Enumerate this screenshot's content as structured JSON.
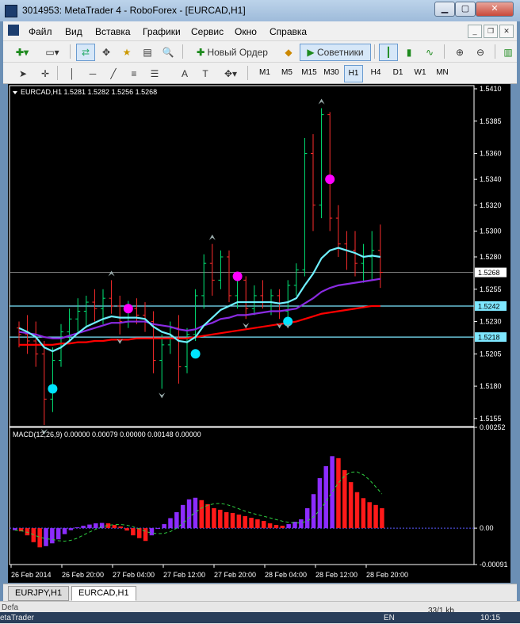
{
  "window": {
    "title": "3014953: MetaTrader 4 - RoboForex - [EURCAD,H1]"
  },
  "menu": [
    "Файл",
    "Вид",
    "Вставка",
    "Графики",
    "Сервис",
    "Окно",
    "Справка"
  ],
  "toolbar": {
    "new_order": "Новый Ордер",
    "advisors": "Советники"
  },
  "timeframes": [
    "M1",
    "M5",
    "M15",
    "M30",
    "H1",
    "H4",
    "D1",
    "W1",
    "MN"
  ],
  "active_timeframe": "H1",
  "chart": {
    "header": "EURCAD,H1  1.5281 1.5282 1.5256 1.5268",
    "price_ticks": [
      "1.5410",
      "1.5385",
      "1.5360",
      "1.5340",
      "1.5320",
      "1.5300",
      "1.5280",
      "1.5255",
      "1.5230",
      "1.5205",
      "1.5180",
      "1.5155"
    ],
    "current_price": "1.5268",
    "hline_upper": "1.5242",
    "hline_lower": "1.5218",
    "macd_header": "MACD(12,26,9) 0.00000 0.00079 0.00000 0.00148 0.00000",
    "macd_ticks": [
      "0.00252",
      "0.00",
      "-0.00091"
    ],
    "time_labels": [
      "26 Feb 2014",
      "26 Feb 20:00",
      "27 Feb 04:00",
      "27 Feb 12:00",
      "27 Feb 20:00",
      "28 Feb 04:00",
      "28 Feb 12:00",
      "28 Feb 20:00"
    ],
    "colors": {
      "bg": "#000000",
      "bull": "#00e676",
      "bear": "#ff2d2d",
      "ma_fast": "#6ff0ff",
      "ma_mid": "#8a2be2",
      "ma_slow": "#ff0000",
      "hline": "#7ee7ff",
      "macd_up": "#8c2cff",
      "macd_down": "#ff1a1a",
      "signal": "#2ecc40"
    }
  },
  "chart_data": {
    "type": "candlestick",
    "symbol": "EURCAD",
    "timeframe": "H1",
    "ylim": [
      1.515,
      1.541
    ],
    "candles": [
      [
        1.5225,
        1.523,
        1.521,
        1.522
      ],
      [
        1.522,
        1.5235,
        1.5205,
        1.5215
      ],
      [
        1.5215,
        1.523,
        1.5195,
        1.5205
      ],
      [
        1.5205,
        1.5215,
        1.515,
        1.517
      ],
      [
        1.517,
        1.521,
        1.516,
        1.52
      ],
      [
        1.52,
        1.5228,
        1.5195,
        1.5222
      ],
      [
        1.5222,
        1.524,
        1.5215,
        1.5232
      ],
      [
        1.5232,
        1.5248,
        1.5222,
        1.5238
      ],
      [
        1.5238,
        1.525,
        1.5225,
        1.5245
      ],
      [
        1.5245,
        1.5255,
        1.523,
        1.524
      ],
      [
        1.524,
        1.5255,
        1.5228,
        1.5248
      ],
      [
        1.5248,
        1.5262,
        1.5236,
        1.5242
      ],
      [
        1.5242,
        1.525,
        1.522,
        1.523
      ],
      [
        1.523,
        1.5246,
        1.5225,
        1.524
      ],
      [
        1.524,
        1.5248,
        1.5228,
        1.5235
      ],
      [
        1.5235,
        1.5245,
        1.5222,
        1.523
      ],
      [
        1.523,
        1.5238,
        1.519,
        1.52
      ],
      [
        1.52,
        1.522,
        1.5178,
        1.5212
      ],
      [
        1.5212,
        1.523,
        1.5205,
        1.5225
      ],
      [
        1.5225,
        1.5235,
        1.5182,
        1.5195
      ],
      [
        1.5195,
        1.5225,
        1.519,
        1.522
      ],
      [
        1.522,
        1.5255,
        1.5215,
        1.525
      ],
      [
        1.525,
        1.5282,
        1.524,
        1.5275
      ],
      [
        1.5275,
        1.529,
        1.525,
        1.5262
      ],
      [
        1.5262,
        1.5285,
        1.5255,
        1.528
      ],
      [
        1.528,
        1.5285,
        1.5245,
        1.525
      ],
      [
        1.525,
        1.5268,
        1.524,
        1.5262
      ],
      [
        1.5262,
        1.5265,
        1.5232,
        1.524
      ],
      [
        1.524,
        1.5258,
        1.5235,
        1.525
      ],
      [
        1.525,
        1.5262,
        1.524,
        1.5245
      ],
      [
        1.5245,
        1.5255,
        1.5235,
        1.525
      ],
      [
        1.525,
        1.5255,
        1.5232,
        1.5238
      ],
      [
        1.5238,
        1.5262,
        1.5232,
        1.5258
      ],
      [
        1.5258,
        1.5275,
        1.525,
        1.527
      ],
      [
        1.527,
        1.5372,
        1.5265,
        1.536
      ],
      [
        1.536,
        1.5375,
        1.53,
        1.532
      ],
      [
        1.532,
        1.5395,
        1.531,
        1.539
      ],
      [
        1.539,
        1.5392,
        1.53,
        1.531
      ],
      [
        1.531,
        1.532,
        1.528,
        1.529
      ],
      [
        1.529,
        1.53,
        1.527,
        1.5285
      ],
      [
        1.5285,
        1.53,
        1.5265,
        1.5275
      ],
      [
        1.5275,
        1.529,
        1.526,
        1.528
      ],
      [
        1.528,
        1.53,
        1.5262,
        1.5285
      ],
      [
        1.5285,
        1.5305,
        1.5256,
        1.5268
      ]
    ],
    "ma_fast": [
      1.5225,
      1.5222,
      1.5218,
      1.521,
      1.5207,
      1.521,
      1.5215,
      1.5221,
      1.5226,
      1.5229,
      1.5232,
      1.5234,
      1.5233,
      1.5233,
      1.5233,
      1.5232,
      1.5226,
      1.5222,
      1.522,
      1.5215,
      1.5214,
      1.5218,
      1.5227,
      1.5233,
      1.5239,
      1.5242,
      1.5245,
      1.5245,
      1.5245,
      1.5245,
      1.5245,
      1.5244,
      1.5245,
      1.5248,
      1.5258,
      1.5267,
      1.5279,
      1.5285,
      1.5287,
      1.5285,
      1.5283,
      1.528,
      1.5281,
      1.528
    ],
    "ma_mid": [
      1.5222,
      1.5221,
      1.522,
      1.5218,
      1.5217,
      1.5217,
      1.5219,
      1.5221,
      1.5223,
      1.5225,
      1.5227,
      1.5229,
      1.5229,
      1.523,
      1.523,
      1.523,
      1.5228,
      1.5227,
      1.5226,
      1.5224,
      1.5223,
      1.5224,
      1.5227,
      1.5229,
      1.5232,
      1.5233,
      1.5235,
      1.5235,
      1.5236,
      1.5237,
      1.5238,
      1.5238,
      1.5239,
      1.524,
      1.5244,
      1.5248,
      1.5253,
      1.5256,
      1.5258,
      1.5259,
      1.526,
      1.5261,
      1.5262,
      1.5263
    ],
    "ma_slow": [
      1.5212,
      1.5212,
      1.5212,
      1.5212,
      1.5212,
      1.5213,
      1.5213,
      1.5214,
      1.5214,
      1.5215,
      1.5215,
      1.5216,
      1.5216,
      1.5216,
      1.5217,
      1.5217,
      1.5217,
      1.5217,
      1.5217,
      1.5217,
      1.5217,
      1.5218,
      1.5219,
      1.522,
      1.5221,
      1.5222,
      1.5223,
      1.5224,
      1.5225,
      1.5226,
      1.5227,
      1.5228,
      1.5229,
      1.523,
      1.5232,
      1.5234,
      1.5236,
      1.5237,
      1.5238,
      1.5239,
      1.524,
      1.5241,
      1.5242,
      1.5242
    ],
    "signals_buy": [
      [
        4,
        1.5178
      ],
      [
        21,
        1.5205
      ],
      [
        32,
        1.523
      ]
    ],
    "signals_sell": [
      [
        13,
        1.524
      ],
      [
        26,
        1.5265
      ],
      [
        37,
        1.534
      ]
    ],
    "macd_ylim": [
      -0.00091,
      0.00252
    ],
    "macd_hist": [
      -5e-05,
      -8e-05,
      -0.00018,
      -0.00035,
      -0.00048,
      -0.00045,
      -0.00038,
      -0.00028,
      -0.00015,
      -5e-05,
      2e-05,
      6e-05,
      9e-05,
      0.00012,
      0.00013,
      0.00012,
      8e-05,
      4e-05,
      -6e-05,
      -0.00018,
      -0.00025,
      -0.00032,
      -0.00018,
      -2e-05,
      0.0001,
      0.00025,
      0.0004,
      0.00058,
      0.00072,
      0.00076,
      0.0007,
      0.0006,
      0.0005,
      0.00046,
      0.0004,
      0.00038,
      0.00034,
      0.0003,
      0.00026,
      0.00022,
      0.00018,
      0.00012,
      8e-05,
      6e-05,
      0.0001,
      0.00016,
      0.00022,
      0.0005,
      0.00085,
      0.00125,
      0.00155,
      0.0018,
      0.00175,
      0.00145,
      0.00115,
      0.0009,
      0.00075,
      0.00065,
      0.00058,
      0.0005
    ]
  },
  "tabs": [
    "EURJPY,H1",
    "EURCAD,H1"
  ],
  "active_tab": "EURCAD,H1",
  "status": {
    "left": "Defa",
    "size": "33/1 kb"
  },
  "taskbar": {
    "app": "etaTrader",
    "lang": "EN",
    "clock": "10:15"
  }
}
